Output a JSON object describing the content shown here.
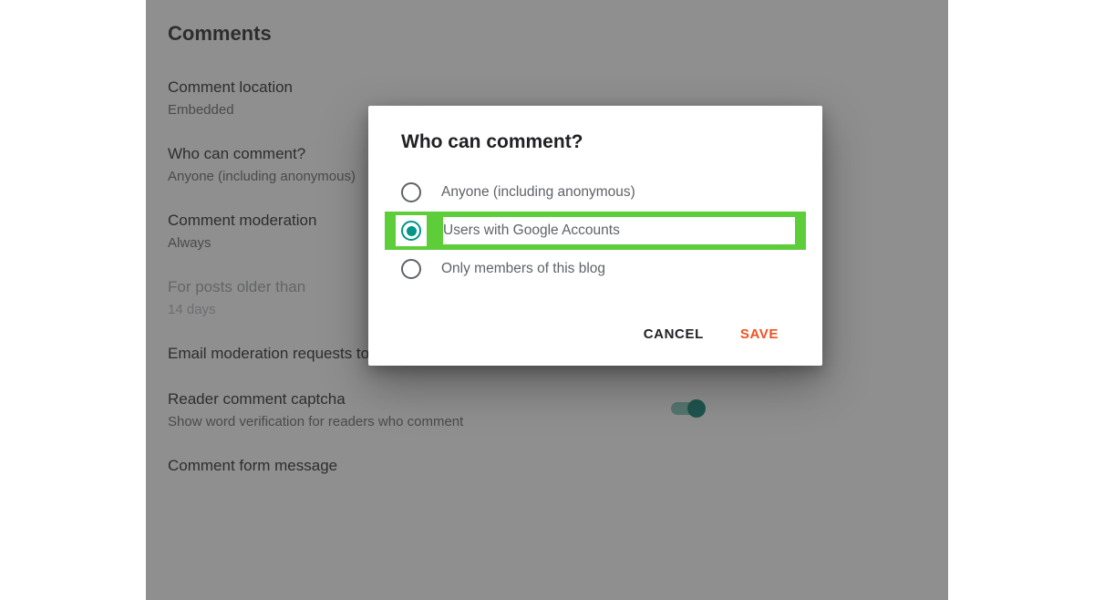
{
  "section": {
    "title": "Comments",
    "items": [
      {
        "label": "Comment location",
        "value": "Embedded"
      },
      {
        "label": "Who can comment?",
        "value": "Anyone (including anonymous)"
      },
      {
        "label": "Comment moderation",
        "value": "Always"
      },
      {
        "label": "For posts older than",
        "value": "14 days",
        "disabled": true
      },
      {
        "label": "Email moderation requests to"
      }
    ],
    "captcha": {
      "label": "Reader comment captcha",
      "description": "Show word verification for readers who comment",
      "enabled": true
    },
    "formMessage": {
      "label": "Comment form message"
    }
  },
  "dialog": {
    "title": "Who can comment?",
    "options": [
      {
        "label": "Anyone (including anonymous)",
        "selected": false,
        "highlighted": false
      },
      {
        "label": "Users with Google Accounts",
        "selected": true,
        "highlighted": true
      },
      {
        "label": "Only members of this blog",
        "selected": false,
        "highlighted": false
      }
    ],
    "actions": {
      "cancel": "CANCEL",
      "save": "SAVE"
    }
  }
}
